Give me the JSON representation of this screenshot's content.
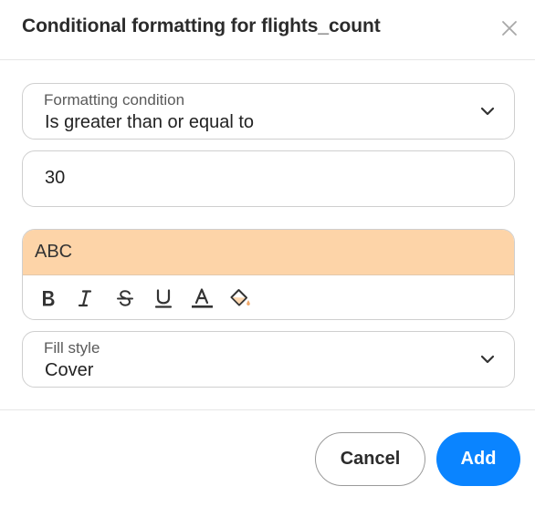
{
  "dialog": {
    "title": "Conditional formatting for flights_count",
    "close_icon": "close-icon"
  },
  "condition": {
    "label": "Formatting condition",
    "value": "Is greater than or equal to",
    "icon": "chevron-down-icon"
  },
  "threshold": {
    "value": "30"
  },
  "style": {
    "preview_text": "ABC",
    "preview_background": "#fdd4a8",
    "toolbar": [
      "bold-icon",
      "italic-icon",
      "strikethrough-icon",
      "underline-icon",
      "text-color-icon",
      "fill-color-icon"
    ]
  },
  "fill_style": {
    "label": "Fill style",
    "value": "Cover",
    "icon": "chevron-down-icon"
  },
  "footer": {
    "cancel_label": "Cancel",
    "add_label": "Add",
    "accent": "#0a84ff"
  }
}
